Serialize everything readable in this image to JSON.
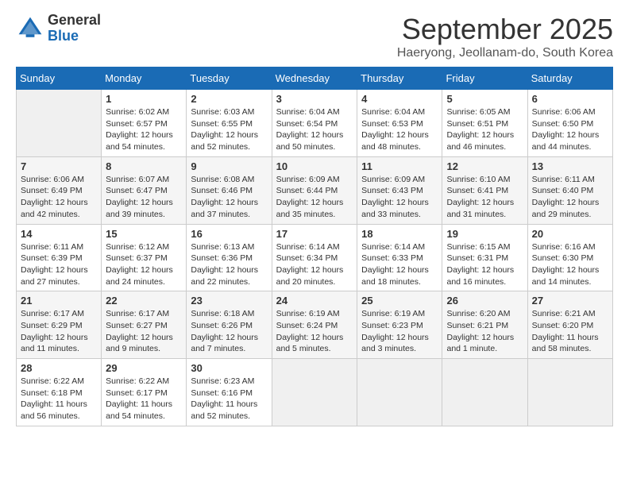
{
  "header": {
    "logo_general": "General",
    "logo_blue": "Blue",
    "month_title": "September 2025",
    "location": "Haeryong, Jeollanam-do, South Korea"
  },
  "days_of_week": [
    "Sunday",
    "Monday",
    "Tuesday",
    "Wednesday",
    "Thursday",
    "Friday",
    "Saturday"
  ],
  "weeks": [
    [
      {
        "day": "",
        "empty": true
      },
      {
        "day": "1",
        "sunrise": "6:02 AM",
        "sunset": "6:57 PM",
        "daylight": "12 hours and 54 minutes."
      },
      {
        "day": "2",
        "sunrise": "6:03 AM",
        "sunset": "6:55 PM",
        "daylight": "12 hours and 52 minutes."
      },
      {
        "day": "3",
        "sunrise": "6:04 AM",
        "sunset": "6:54 PM",
        "daylight": "12 hours and 50 minutes."
      },
      {
        "day": "4",
        "sunrise": "6:04 AM",
        "sunset": "6:53 PM",
        "daylight": "12 hours and 48 minutes."
      },
      {
        "day": "5",
        "sunrise": "6:05 AM",
        "sunset": "6:51 PM",
        "daylight": "12 hours and 46 minutes."
      },
      {
        "day": "6",
        "sunrise": "6:06 AM",
        "sunset": "6:50 PM",
        "daylight": "12 hours and 44 minutes."
      }
    ],
    [
      {
        "day": "7",
        "sunrise": "6:06 AM",
        "sunset": "6:49 PM",
        "daylight": "12 hours and 42 minutes."
      },
      {
        "day": "8",
        "sunrise": "6:07 AM",
        "sunset": "6:47 PM",
        "daylight": "12 hours and 39 minutes."
      },
      {
        "day": "9",
        "sunrise": "6:08 AM",
        "sunset": "6:46 PM",
        "daylight": "12 hours and 37 minutes."
      },
      {
        "day": "10",
        "sunrise": "6:09 AM",
        "sunset": "6:44 PM",
        "daylight": "12 hours and 35 minutes."
      },
      {
        "day": "11",
        "sunrise": "6:09 AM",
        "sunset": "6:43 PM",
        "daylight": "12 hours and 33 minutes."
      },
      {
        "day": "12",
        "sunrise": "6:10 AM",
        "sunset": "6:41 PM",
        "daylight": "12 hours and 31 minutes."
      },
      {
        "day": "13",
        "sunrise": "6:11 AM",
        "sunset": "6:40 PM",
        "daylight": "12 hours and 29 minutes."
      }
    ],
    [
      {
        "day": "14",
        "sunrise": "6:11 AM",
        "sunset": "6:39 PM",
        "daylight": "12 hours and 27 minutes."
      },
      {
        "day": "15",
        "sunrise": "6:12 AM",
        "sunset": "6:37 PM",
        "daylight": "12 hours and 24 minutes."
      },
      {
        "day": "16",
        "sunrise": "6:13 AM",
        "sunset": "6:36 PM",
        "daylight": "12 hours and 22 minutes."
      },
      {
        "day": "17",
        "sunrise": "6:14 AM",
        "sunset": "6:34 PM",
        "daylight": "12 hours and 20 minutes."
      },
      {
        "day": "18",
        "sunrise": "6:14 AM",
        "sunset": "6:33 PM",
        "daylight": "12 hours and 18 minutes."
      },
      {
        "day": "19",
        "sunrise": "6:15 AM",
        "sunset": "6:31 PM",
        "daylight": "12 hours and 16 minutes."
      },
      {
        "day": "20",
        "sunrise": "6:16 AM",
        "sunset": "6:30 PM",
        "daylight": "12 hours and 14 minutes."
      }
    ],
    [
      {
        "day": "21",
        "sunrise": "6:17 AM",
        "sunset": "6:29 PM",
        "daylight": "12 hours and 11 minutes."
      },
      {
        "day": "22",
        "sunrise": "6:17 AM",
        "sunset": "6:27 PM",
        "daylight": "12 hours and 9 minutes."
      },
      {
        "day": "23",
        "sunrise": "6:18 AM",
        "sunset": "6:26 PM",
        "daylight": "12 hours and 7 minutes."
      },
      {
        "day": "24",
        "sunrise": "6:19 AM",
        "sunset": "6:24 PM",
        "daylight": "12 hours and 5 minutes."
      },
      {
        "day": "25",
        "sunrise": "6:19 AM",
        "sunset": "6:23 PM",
        "daylight": "12 hours and 3 minutes."
      },
      {
        "day": "26",
        "sunrise": "6:20 AM",
        "sunset": "6:21 PM",
        "daylight": "12 hours and 1 minute."
      },
      {
        "day": "27",
        "sunrise": "6:21 AM",
        "sunset": "6:20 PM",
        "daylight": "11 hours and 58 minutes."
      }
    ],
    [
      {
        "day": "28",
        "sunrise": "6:22 AM",
        "sunset": "6:18 PM",
        "daylight": "11 hours and 56 minutes."
      },
      {
        "day": "29",
        "sunrise": "6:22 AM",
        "sunset": "6:17 PM",
        "daylight": "11 hours and 54 minutes."
      },
      {
        "day": "30",
        "sunrise": "6:23 AM",
        "sunset": "6:16 PM",
        "daylight": "11 hours and 52 minutes."
      },
      {
        "day": "",
        "empty": true
      },
      {
        "day": "",
        "empty": true
      },
      {
        "day": "",
        "empty": true
      },
      {
        "day": "",
        "empty": true
      }
    ]
  ],
  "labels": {
    "sunrise_prefix": "Sunrise: ",
    "sunset_prefix": "Sunset: ",
    "daylight_prefix": "Daylight: "
  }
}
